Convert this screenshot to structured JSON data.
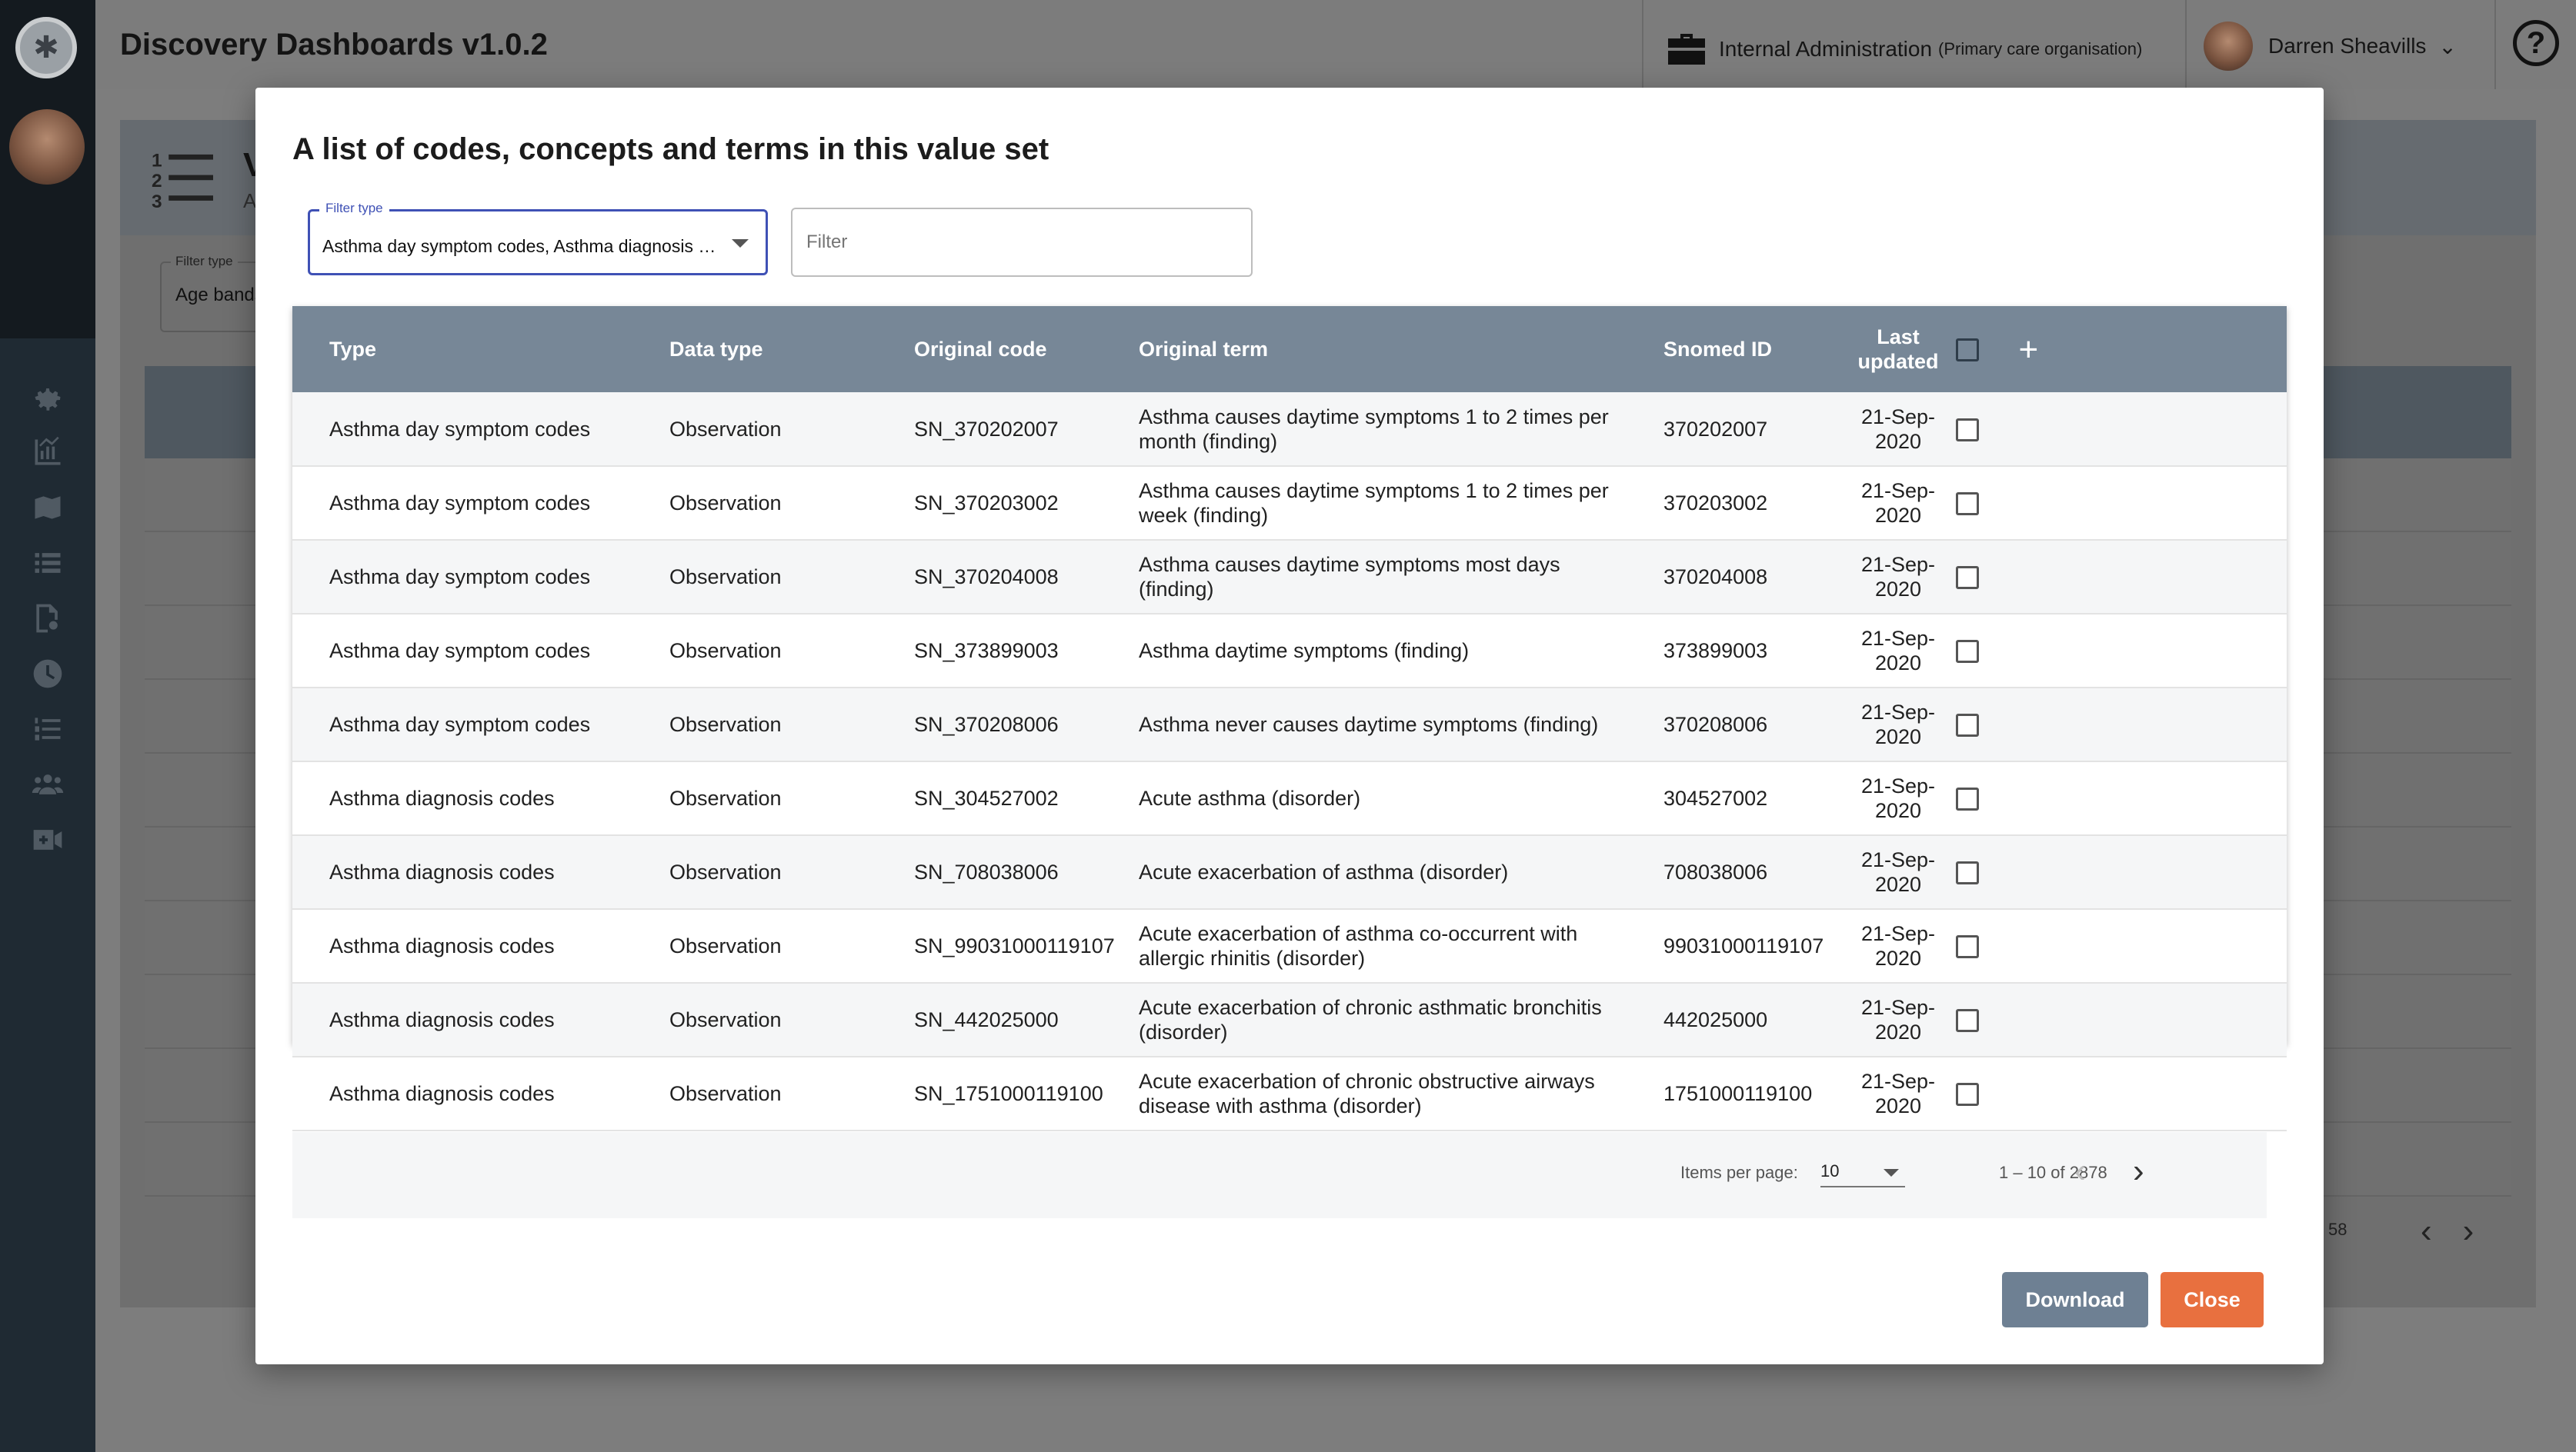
{
  "app": {
    "title": "Discovery Dashboards v1.0.2",
    "org_name": "Internal Administration",
    "org_type": "(Primary care organisation)",
    "user_name": "Darren Sheavills",
    "help_glyph": "?"
  },
  "sidebar": {
    "icons": [
      "settings-icon",
      "chart-icon",
      "map-icon",
      "list-icon",
      "search-document-icon",
      "clock-icon",
      "numbered-list-icon",
      "people-icon",
      "video-add-icon"
    ]
  },
  "background_page": {
    "title_letter": "V",
    "subtitle_letter": "A",
    "filter_label": "Filter type",
    "filter_value": "Age bands",
    "pager_fragment": "58"
  },
  "modal": {
    "title": "A list of codes, concepts and terms in this value set",
    "filter_type_label": "Filter type",
    "filter_type_value": "Asthma day symptom codes, Asthma diagnosis codes",
    "filter_placeholder": "Filter",
    "columns": {
      "type": "Type",
      "data_type": "Data type",
      "original_code": "Original code",
      "original_term": "Original term",
      "snomed_id": "Snomed ID",
      "last_updated": "Last updated",
      "add": "+"
    },
    "rows": [
      {
        "type": "Asthma day symptom codes",
        "data_type": "Observation",
        "original_code": "SN_370202007",
        "original_term": "Asthma causes daytime symptoms 1 to 2 times per month (finding)",
        "snomed_id": "370202007",
        "last_updated": "21-Sep-2020"
      },
      {
        "type": "Asthma day symptom codes",
        "data_type": "Observation",
        "original_code": "SN_370203002",
        "original_term": "Asthma causes daytime symptoms 1 to 2 times per week (finding)",
        "snomed_id": "370203002",
        "last_updated": "21-Sep-2020"
      },
      {
        "type": "Asthma day symptom codes",
        "data_type": "Observation",
        "original_code": "SN_370204008",
        "original_term": "Asthma causes daytime symptoms most days (finding)",
        "snomed_id": "370204008",
        "last_updated": "21-Sep-2020"
      },
      {
        "type": "Asthma day symptom codes",
        "data_type": "Observation",
        "original_code": "SN_373899003",
        "original_term": "Asthma daytime symptoms (finding)",
        "snomed_id": "373899003",
        "last_updated": "21-Sep-2020"
      },
      {
        "type": "Asthma day symptom codes",
        "data_type": "Observation",
        "original_code": "SN_370208006",
        "original_term": "Asthma never causes daytime symptoms (finding)",
        "snomed_id": "370208006",
        "last_updated": "21-Sep-2020"
      },
      {
        "type": "Asthma diagnosis codes",
        "data_type": "Observation",
        "original_code": "SN_304527002",
        "original_term": "Acute asthma (disorder)",
        "snomed_id": "304527002",
        "last_updated": "21-Sep-2020"
      },
      {
        "type": "Asthma diagnosis codes",
        "data_type": "Observation",
        "original_code": "SN_708038006",
        "original_term": "Acute exacerbation of asthma (disorder)",
        "snomed_id": "708038006",
        "last_updated": "21-Sep-2020"
      },
      {
        "type": "Asthma diagnosis codes",
        "data_type": "Observation",
        "original_code": "SN_99031000119107",
        "original_term": "Acute exacerbation of asthma co-occurrent with allergic rhinitis (disorder)",
        "snomed_id": "99031000119107",
        "last_updated": "21-Sep-2020"
      },
      {
        "type": "Asthma diagnosis codes",
        "data_type": "Observation",
        "original_code": "SN_442025000",
        "original_term": "Acute exacerbation of chronic asthmatic bronchitis (disorder)",
        "snomed_id": "442025000",
        "last_updated": "21-Sep-2020"
      },
      {
        "type": "Asthma diagnosis codes",
        "data_type": "Observation",
        "original_code": "SN_1751000119100",
        "original_term": "Acute exacerbation of chronic obstructive airways disease with asthma (disorder)",
        "snomed_id": "1751000119100",
        "last_updated": "21-Sep-2020"
      }
    ],
    "paginator": {
      "items_per_page_label": "Items per page:",
      "items_per_page_value": "10",
      "range_label": "1 – 10 of 2878"
    },
    "buttons": {
      "download": "Download",
      "close": "Close"
    }
  },
  "colors": {
    "table_header": "#778797",
    "download_button": "#6e8093",
    "close_button": "#e8703f",
    "focus_outline": "#3f51b5"
  }
}
